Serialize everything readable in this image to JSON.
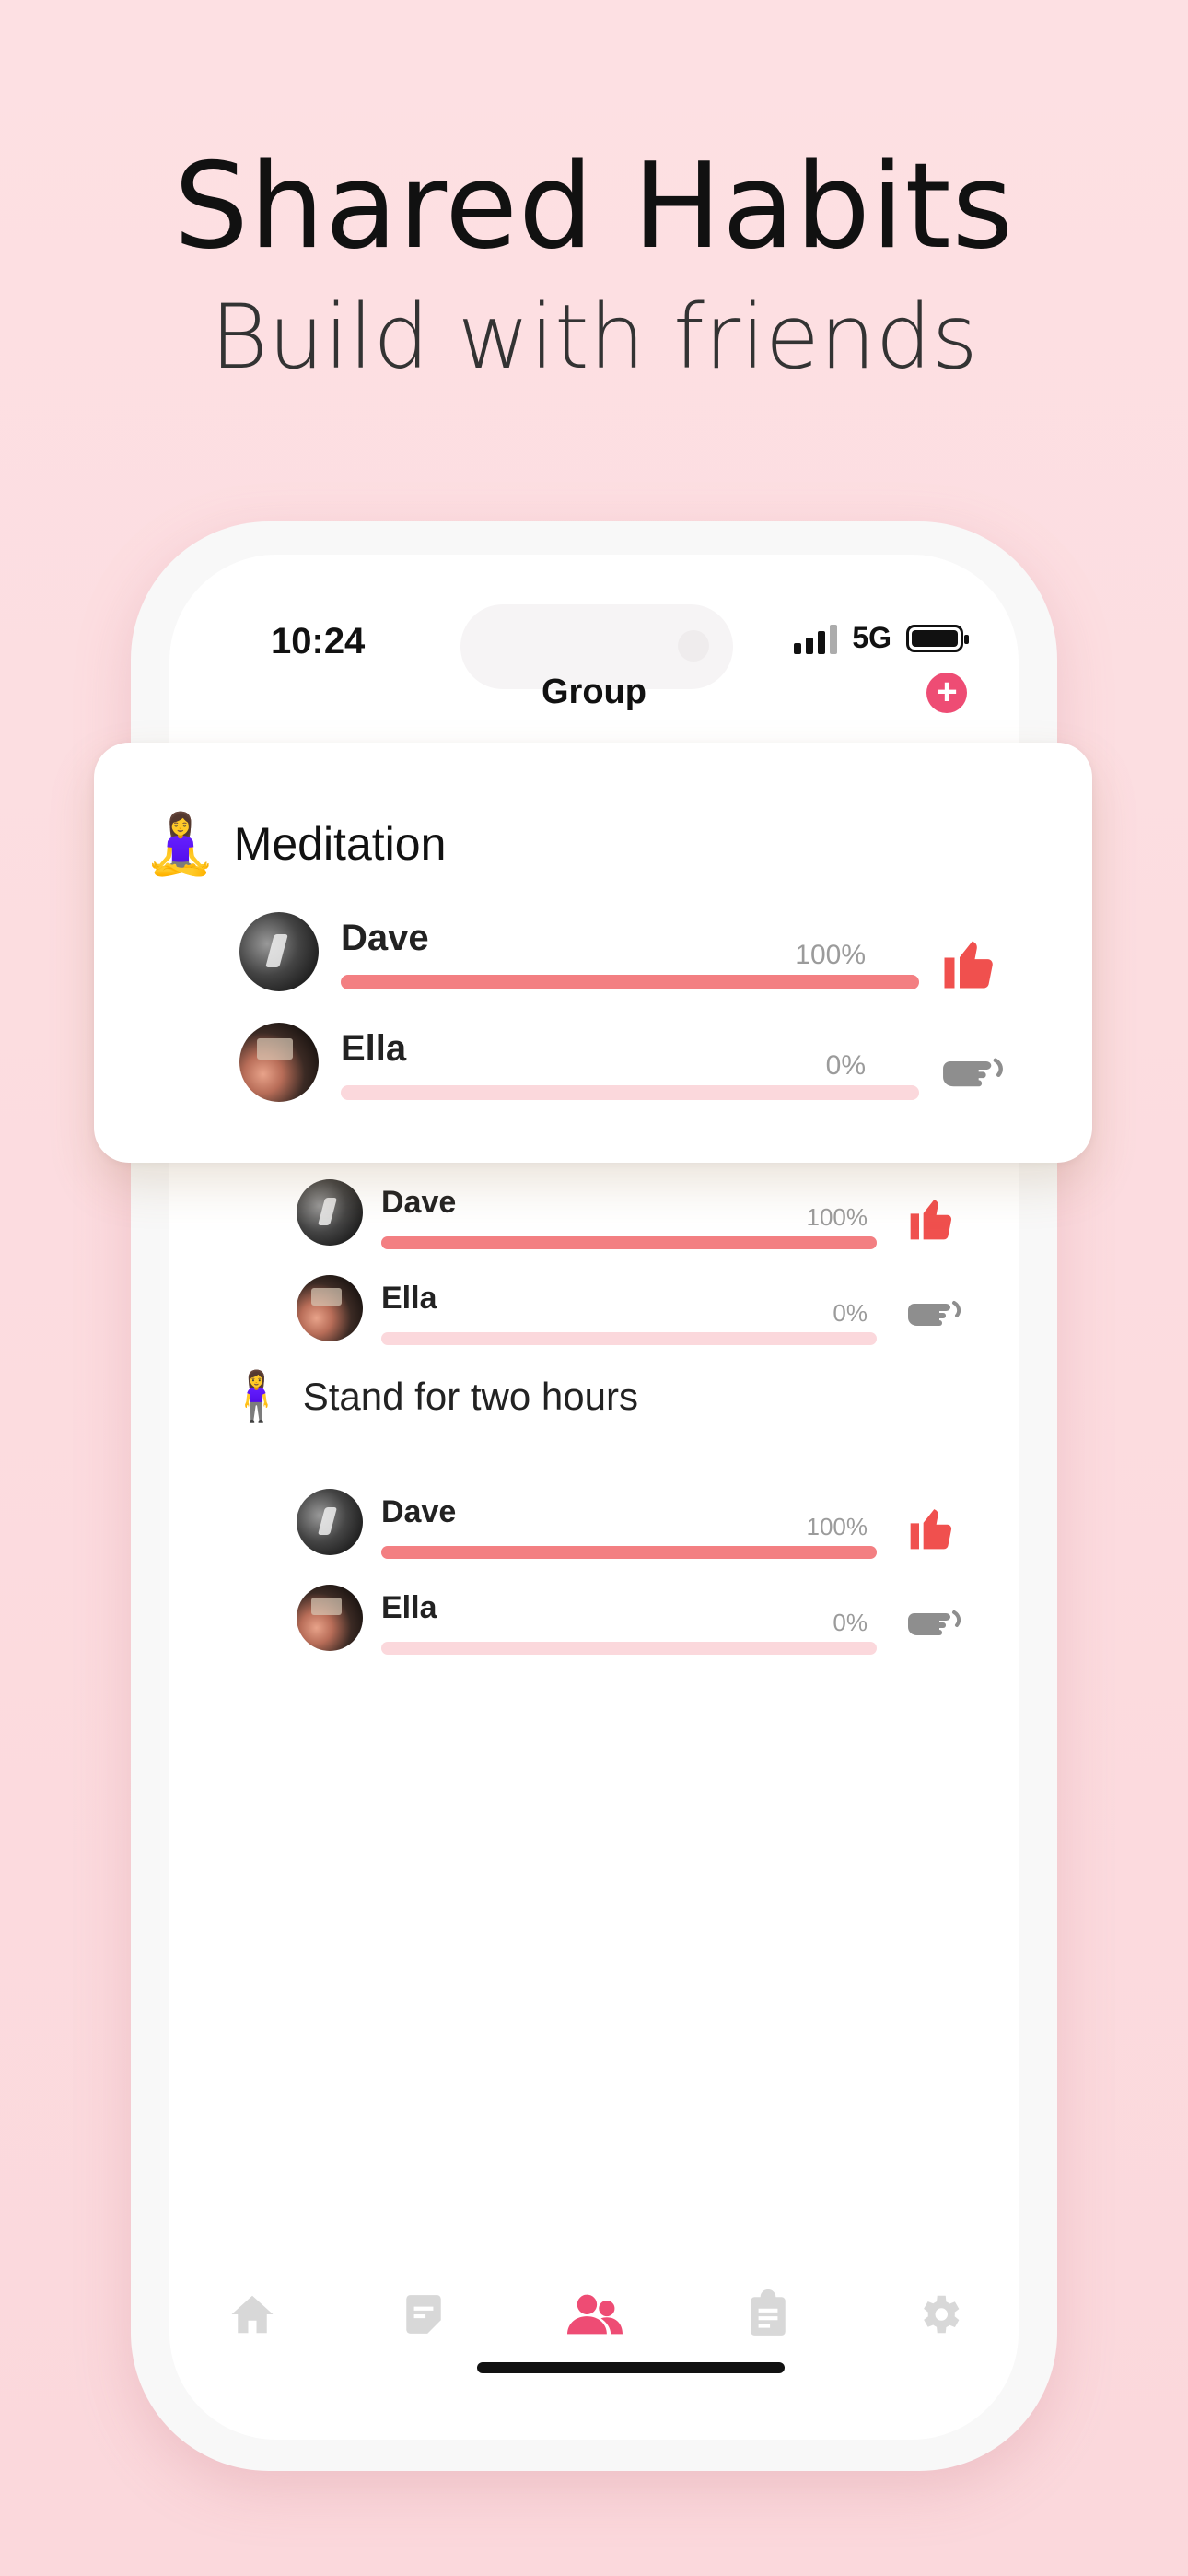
{
  "header": {
    "title": "Shared Habits",
    "subtitle": "Build with friends"
  },
  "status_bar": {
    "time": "10:24",
    "network": "5G"
  },
  "nav": {
    "title": "Group",
    "add_icon": "plus-circle-icon"
  },
  "featured_habit": {
    "emoji": "🧘‍♀️",
    "title": "Meditation",
    "members": [
      {
        "name": "Dave",
        "progress_label": "100%",
        "progress": 1.0,
        "reaction": "thumbs-up-icon"
      },
      {
        "name": "Ella",
        "progress_label": "0%",
        "progress": 0.0,
        "reaction": "poke-hand-icon"
      }
    ]
  },
  "habits": [
    {
      "emoji": "",
      "title": "",
      "members": [
        {
          "name": "Dave",
          "progress_label": "100%",
          "progress": 1.0,
          "reaction": "thumbs-up-icon"
        },
        {
          "name": "Ella",
          "progress_label": "0%",
          "progress": 0.0,
          "reaction": "poke-hand-icon"
        }
      ]
    },
    {
      "emoji": "🧍‍♀️",
      "title": "Stand for two hours",
      "members": [
        {
          "name": "Dave",
          "progress_label": "100%",
          "progress": 1.0,
          "reaction": "thumbs-up-icon"
        },
        {
          "name": "Ella",
          "progress_label": "0%",
          "progress": 0.0,
          "reaction": "poke-hand-icon"
        }
      ]
    }
  ],
  "tabs": [
    {
      "icon": "home-icon",
      "active": false
    },
    {
      "icon": "note-icon",
      "active": false
    },
    {
      "icon": "group-icon",
      "active": true
    },
    {
      "icon": "clipboard-icon",
      "active": false
    },
    {
      "icon": "gear-icon",
      "active": false
    }
  ],
  "colors": {
    "accent": "#ee4c74",
    "progress_fill": "#f37f82",
    "progress_track": "#fbd8dc",
    "thumb": "#f0504e",
    "inactive_icon": "#d8d8d8"
  }
}
